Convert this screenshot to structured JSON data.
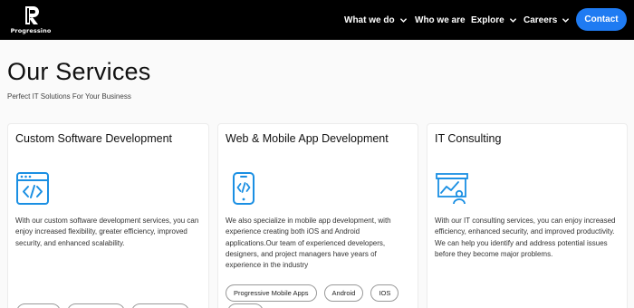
{
  "brand": {
    "name": "Progressino"
  },
  "nav": {
    "items": [
      {
        "label": "What we do"
      },
      {
        "label": "Who we are"
      },
      {
        "label": "Explore"
      },
      {
        "label": "Careers"
      }
    ],
    "contact_label": "Contact"
  },
  "page": {
    "title": "Our Services",
    "subtitle": "Perfect IT Solutions For Your Business"
  },
  "cards": [
    {
      "title": "Custom Software Development",
      "icon": "code-window-icon",
      "description": "With our custom software development services, you can enjoy increased flexibility, greater efficiency, improved security, and enhanced scalability.",
      "tags": []
    },
    {
      "title": "Web & Mobile App Development",
      "icon": "mobile-code-icon",
      "description": "We also specialize in mobile app development, with experience creating both iOS and Android applications.Our team of experienced developers, designers, and project managers have years of experience in the industry",
      "tags": [
        "Progressive Mobile Apps",
        "Android",
        "IOS"
      ]
    },
    {
      "title": "IT Consulting",
      "icon": "presentation-chart-icon",
      "description": "With our IT consulting services, you can enjoy increased efficiency, enhanced security, and improved productivity. We can help you identify and address potential issues before they become major problems.",
      "tags": []
    }
  ],
  "colors": {
    "header_bg": "#000000",
    "accent": "#1f7bf2",
    "icon": "#1a8fe3"
  }
}
